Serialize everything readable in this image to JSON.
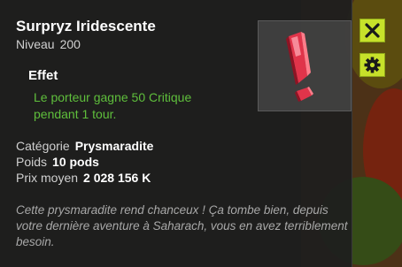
{
  "item": {
    "name": "Surpryz Iridescente",
    "level_label": "Niveau",
    "level_value": "200"
  },
  "effect": {
    "title": "Effet",
    "text": "Le porteur gagne 50 Critique pendant 1 tour."
  },
  "properties": [
    {
      "label": "Catégorie",
      "value": "Prysmaradite"
    },
    {
      "label": "Poids",
      "value": "10 pods"
    },
    {
      "label": "Prix moyen",
      "value": "2 028 156 K"
    }
  ],
  "description": "Cette prysmaradite rend chanceux ! Ça tombe bien, depuis votre dernière aventure à Saharach, vous en avez terriblement besoin.",
  "buttons": {
    "close_icon": "close-icon",
    "settings_icon": "gear-icon"
  },
  "item_icon": "red-exclamation-gem-icon",
  "colors": {
    "effect_text": "#5fbf3c",
    "button_bg": "#c7e12a",
    "gem_red": "#e0344a"
  }
}
